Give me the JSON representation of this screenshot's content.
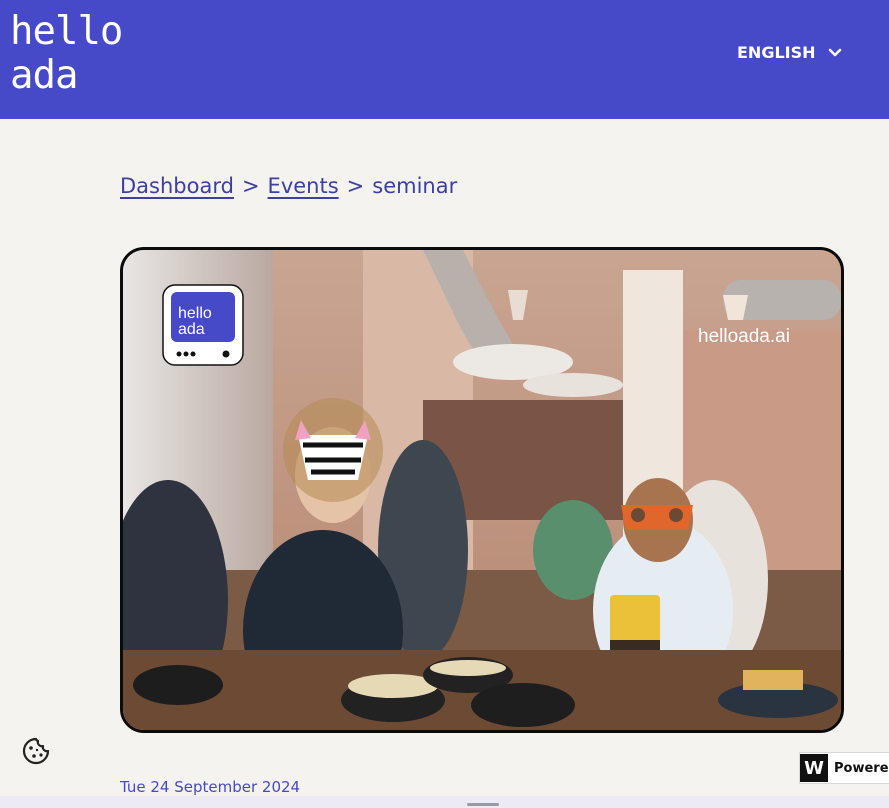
{
  "header": {
    "logo_line1": "hello",
    "logo_line2": "ada",
    "language": "ENGLISH"
  },
  "breadcrumb": {
    "items": [
      "Dashboard",
      "Events"
    ],
    "current": "seminar",
    "separator": ">"
  },
  "event": {
    "image_logo_line1": "hello",
    "image_logo_line2": "ada",
    "image_watermark": "helloada.ai",
    "date": "Tue 24 September 2024"
  },
  "widget": {
    "powered_label": "Powered",
    "powered_logo": "W"
  },
  "icons": {
    "language_chevron": "chevron-down-icon",
    "cookie": "cookie-icon"
  },
  "colors": {
    "brand": "#4649c8",
    "background": "#f4f3ef",
    "link": "#3d40a3"
  }
}
